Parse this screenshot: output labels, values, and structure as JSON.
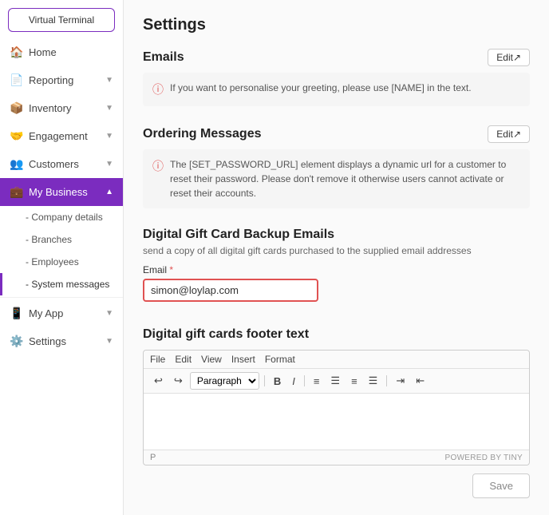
{
  "sidebar": {
    "top_button": "Virtual Terminal",
    "items": [
      {
        "id": "home",
        "label": "Home",
        "icon": "🏠",
        "expandable": false
      },
      {
        "id": "reporting",
        "label": "Reporting",
        "icon": "📄",
        "expandable": true
      },
      {
        "id": "inventory",
        "label": "Inventory",
        "icon": "📦",
        "expandable": true
      },
      {
        "id": "engagement",
        "label": "Engagement",
        "icon": "🤝",
        "expandable": true
      },
      {
        "id": "customers",
        "label": "Customers",
        "icon": "👥",
        "expandable": true
      },
      {
        "id": "my-business",
        "label": "My Business",
        "icon": "💼",
        "expandable": true,
        "active": true
      }
    ],
    "sub_items": [
      {
        "id": "company-details",
        "label": "- Company details"
      },
      {
        "id": "branches",
        "label": "- Branches"
      },
      {
        "id": "employees",
        "label": "- Employees"
      },
      {
        "id": "system-messages",
        "label": "- System messages",
        "active": true
      }
    ],
    "bottom_items": [
      {
        "id": "my-app",
        "label": "My App",
        "icon": "📱",
        "expandable": true
      },
      {
        "id": "settings",
        "label": "Settings",
        "icon": "⚙️",
        "expandable": true
      }
    ]
  },
  "main": {
    "page_title": "Settings",
    "emails_section": {
      "title": "Emails",
      "edit_btn": "Edit↗",
      "info_text": "If you want to personalise your greeting, please use [NAME] in the text."
    },
    "ordering_messages_section": {
      "title": "Ordering Messages",
      "edit_btn": "Edit↗",
      "info_text": "The [SET_PASSWORD_URL] element displays a dynamic url for a customer to reset their password. Please don't remove it otherwise users cannot activate or reset their accounts."
    },
    "digital_gift_card_section": {
      "title": "Digital Gift Card Backup Emails",
      "subtitle": "send a copy of all digital gift cards purchased to the supplied email addresses",
      "email_label": "Email",
      "required_marker": "*",
      "email_value": "simon@loylap.com"
    },
    "footer_text_section": {
      "title": "Digital gift cards footer text",
      "toolbar_menus": [
        "File",
        "Edit",
        "View",
        "Insert",
        "Format"
      ],
      "paragraph_select": "Paragraph",
      "footer_tag": "P",
      "powered_by": "POWERED BY TINY"
    },
    "save_btn": "Save"
  }
}
